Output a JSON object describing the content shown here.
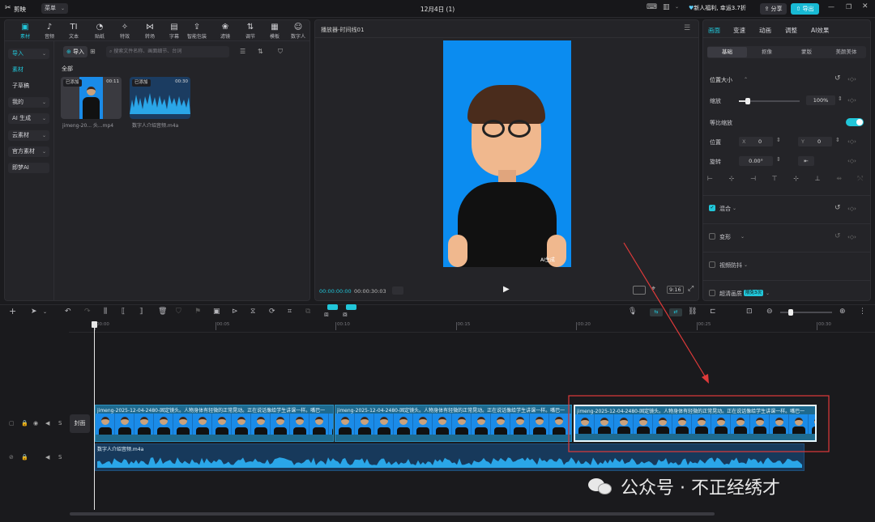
{
  "titlebar": {
    "app_name": "剪映",
    "menu_label": "菜单",
    "title": "12月4日 (1)",
    "promo": "新人福利, 幸运3.7折",
    "share": "分享",
    "export": "导出"
  },
  "toolbar": {
    "tools": [
      {
        "label": "素材",
        "icon": "media-icon",
        "glyph": "▣"
      },
      {
        "label": "音频",
        "icon": "audio-icon",
        "glyph": "♪"
      },
      {
        "label": "文本",
        "icon": "text-icon",
        "glyph": "TI"
      },
      {
        "label": "贴纸",
        "icon": "sticker-icon",
        "glyph": "◔"
      },
      {
        "label": "特效",
        "icon": "effects-icon",
        "glyph": "✧"
      },
      {
        "label": "转场",
        "icon": "transition-icon",
        "glyph": "⋈"
      },
      {
        "label": "字幕",
        "icon": "subtitle-icon",
        "glyph": "▤"
      },
      {
        "label": "智能包装",
        "icon": "smart-pack-icon",
        "glyph": "⇪"
      },
      {
        "label": "滤镜",
        "icon": "filter-icon",
        "glyph": "❀"
      },
      {
        "label": "调节",
        "icon": "adjust-icon",
        "glyph": "⇅"
      },
      {
        "label": "模板",
        "icon": "template-icon",
        "glyph": "▦"
      },
      {
        "label": "数字人",
        "icon": "digital-human-icon",
        "glyph": "☺"
      }
    ]
  },
  "sidebar": {
    "items": [
      {
        "label": "导入",
        "chevron": true
      },
      {
        "label": "素材",
        "chevron": false
      },
      {
        "label": "子草稿",
        "chevron": false
      },
      {
        "label": "我的",
        "chevron": true
      },
      {
        "label": "AI 生成",
        "chevron": true
      },
      {
        "label": "云素材",
        "chevron": true
      },
      {
        "label": "官方素材",
        "chevron": true
      },
      {
        "label": "即梦AI",
        "chevron": false
      }
    ]
  },
  "media": {
    "import_label": "导入",
    "search_placeholder": "搜索文件名称、画面细节、台词",
    "filter_label": "全部",
    "items": [
      {
        "badge": "已添加",
        "duration": "00:11",
        "name": "jimeng-20... 头...mp4"
      },
      {
        "badge": "已添加",
        "duration": "00:30",
        "name": "数字人介绍音频.m4a"
      }
    ]
  },
  "player": {
    "title": "播放器-时间线01",
    "watermark": "AI生成",
    "current_time": "00:00:00:00",
    "total_time": "00:00:30:03",
    "ratio_label": "9:16"
  },
  "inspector": {
    "tabs": [
      "画面",
      "变速",
      "动画",
      "调整",
      "AI效果"
    ],
    "subtabs": [
      "基础",
      "抠像",
      "蒙版",
      "美颜美体"
    ],
    "section_position": "位置大小",
    "scale_label": "缩放",
    "scale_value": "100%",
    "scale_fill": 0.15,
    "uniform_label": "等比缩放",
    "position_label": "位置",
    "x_label": "X",
    "x_value": "0",
    "y_label": "Y",
    "y_value": "0",
    "rotate_label": "旋转",
    "rotate_value": "0.00°",
    "blend_label": "混合",
    "deform_label": "变形",
    "stabilize_label": "视频防抖",
    "hd_label": "超清画质",
    "hd_badge": "限免3次"
  },
  "timeline": {
    "cover_label": "封面",
    "ticks": [
      "00:00",
      "00:05",
      "00:10",
      "00:15",
      "00:20",
      "00:25",
      "00:30"
    ],
    "clip_title": "jimeng-2025-12-04-2480-固定镜头。人物身体有轻微的正常晃动。正在说话像给学生讲课一样。嘴巴一",
    "audio_title": "数字人介绍音频.m4a",
    "track_letter": "S"
  },
  "watermark": {
    "text": "公众号 · 不正经绣才"
  },
  "colors": {
    "accent": "#21c6d9",
    "annotation": "#e03a3a",
    "video_bg": "#1a8be8"
  }
}
